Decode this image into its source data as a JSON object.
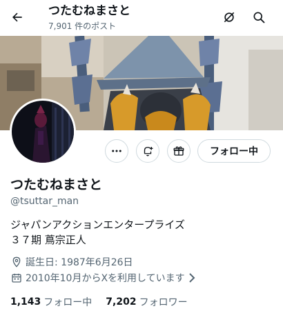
{
  "header": {
    "display_name": "つたむねまさと",
    "post_count": "7,901 件のポスト",
    "back_icon": "arrow-left-icon",
    "hide_icon": "eye-off-icon",
    "search_icon": "search-icon"
  },
  "profile": {
    "display_name": "つたむねまさと",
    "handle": "@tsuttar_man",
    "bio_line_1": "ジャパンアクションエンタープライズ",
    "bio_line_2": "３７期 蔦宗正人",
    "birthday": "誕生日: 1987年6月26日",
    "joined": "2010年10月からXを利用しています"
  },
  "actions": {
    "more_icon": "more-dots-icon",
    "notify_icon": "bell-plus-icon",
    "subscribe_icon": "gift-box-icon",
    "follow_label": "フォロー中"
  },
  "stats": {
    "following_count": "1,143",
    "following_label": "フォロー中",
    "followers_count": "7,202",
    "followers_label": "フォロワー"
  },
  "colors": {
    "text": "#0f1419",
    "secondary": "#536471",
    "border": "#cfd9de"
  }
}
